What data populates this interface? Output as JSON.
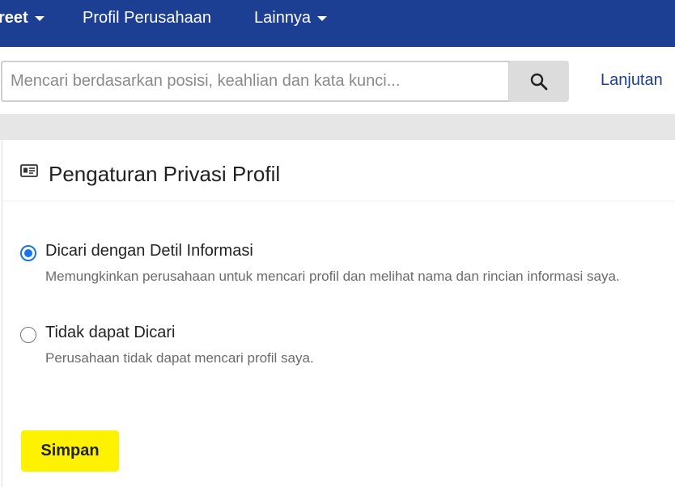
{
  "nav": {
    "items": [
      {
        "label": "reet",
        "has_caret": true
      },
      {
        "label": "Profil Perusahaan",
        "has_caret": false
      },
      {
        "label": "Lainnya",
        "has_caret": true
      }
    ]
  },
  "search": {
    "placeholder": "Mencari berdasarkan posisi, keahlian dan kata kunci...",
    "value": "",
    "button_icon": "search-icon",
    "advanced_label": "Lanjutan"
  },
  "privacy": {
    "title": "Pengaturan Privasi Profil",
    "title_icon": "id-card-icon",
    "options": [
      {
        "label": "Dicari dengan Detil Informasi",
        "description": "Memungkinkan perusahaan untuk mencari profil dan melihat nama dan rincian informasi saya.",
        "selected": true
      },
      {
        "label": "Tidak dapat Dicari",
        "description": "Perusahaan tidak dapat mencari profil saya.",
        "selected": false
      }
    ],
    "save_label": "Simpan"
  },
  "colors": {
    "nav_bg": "#1c3f94",
    "link": "#1c3f94",
    "save_bg": "#fff200",
    "radio_accent": "#1a73e8"
  }
}
